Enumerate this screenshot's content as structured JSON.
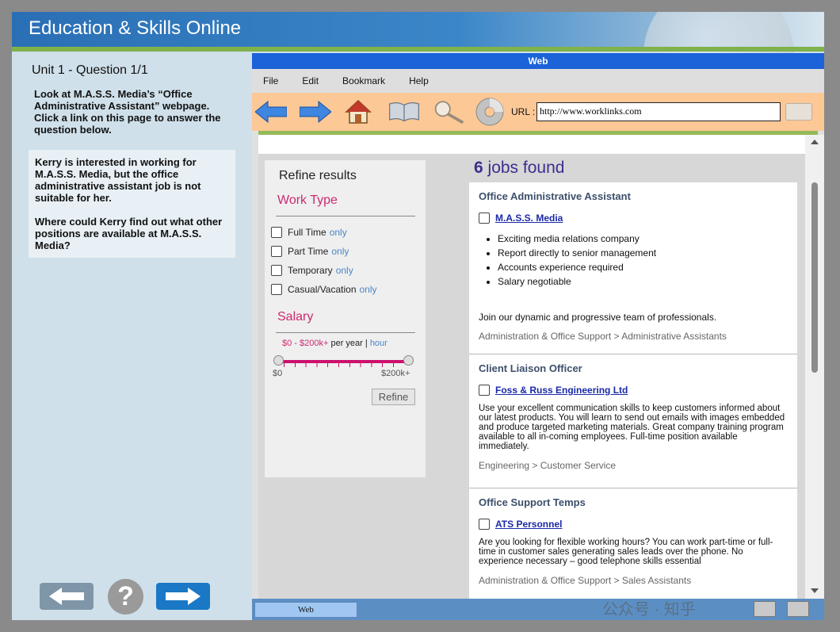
{
  "app": {
    "title": "Education & Skills Online"
  },
  "left_panel": {
    "unit_title": "Unit 1 - Question 1/1",
    "instructions": "Look at M.A.S.S. Media’s “Office Administrative Assistant” webpage. Click a link on this page to answer the question below.",
    "question_p1": "Kerry is interested in working for M.A.S.S. Media, but the office administrative assistant job is not suitable for her.",
    "question_p2": "Where could Kerry find out what other positions are available at M.A.S.S. Media?",
    "help_symbol": "?"
  },
  "browser": {
    "title": "Web",
    "menu": [
      "File",
      "Edit",
      "Bookmark",
      "Help"
    ],
    "toolbar": {
      "icons": [
        "back-arrow-icon",
        "forward-arrow-icon",
        "home-icon",
        "book-icon",
        "search-icon",
        "cd-icon"
      ],
      "url_label": "URL :",
      "url_value": "http://www.worklinks.com"
    },
    "taskbar": {
      "web_button": "Web"
    }
  },
  "refine": {
    "title": "Refine results",
    "work_type_title": "Work Type",
    "only_label": "only",
    "work_types": [
      "Full Time",
      "Part Time",
      "Temporary",
      "Casual/Vacation"
    ],
    "salary_title": "Salary",
    "salary_range": "$0 - $200k+",
    "per_year": "per year",
    "separator": "|",
    "hour": "hour",
    "salary_min": "$0",
    "salary_max": "$200k+",
    "refine_button": "Refine"
  },
  "jobs": {
    "count": "6",
    "found_label": "jobs found",
    "items": [
      {
        "title": "Office Administrative Assistant",
        "company": "M.A.S.S. Media",
        "bullets": [
          "Exciting media relations company",
          "Report directly to senior management",
          "Accounts experience required",
          "Salary negotiable"
        ],
        "description": "Join our dynamic and progressive team of professionals.",
        "category": "Administration & Office Support > Administrative Assistants"
      },
      {
        "title": "Client Liaison Officer",
        "company": "Foss & Russ Engineering Ltd",
        "description": "Use your excellent communication skills to keep customers informed about our latest products. You will learn to send out emails with images embedded and produce targeted marketing materials. Great company training program available to all in-coming employees. Full-time position available immediately.",
        "category": "Engineering > Customer Service"
      },
      {
        "title": "Office Support Temps",
        "company": "ATS Personnel",
        "description": "Are you looking for flexible working hours? You can work part-time or full-time in customer sales generating sales leads over the phone. No experience necessary – good telephone skills essential",
        "category": "Administration & Office Support > Sales Assistants"
      }
    ]
  },
  "watermark": "公众号 · 知乎"
}
